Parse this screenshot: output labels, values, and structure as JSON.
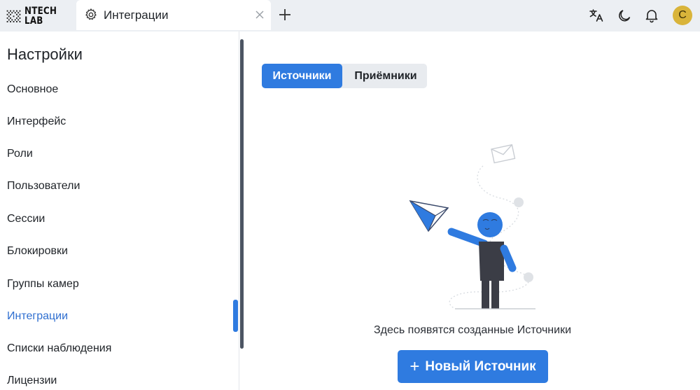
{
  "brand": {
    "line1": "NTECH",
    "line2": "LAB"
  },
  "tab": {
    "label": "Интеграции"
  },
  "user": {
    "initial": "C",
    "avatar_color": "#d9b43a"
  },
  "sidebar": {
    "title": "Настройки",
    "items": [
      {
        "label": "Основное",
        "active": false
      },
      {
        "label": "Интерфейс",
        "active": false
      },
      {
        "label": "Роли",
        "active": false
      },
      {
        "label": "Пользователи",
        "active": false
      },
      {
        "label": "Сессии",
        "active": false
      },
      {
        "label": "Блокировки",
        "active": false
      },
      {
        "label": "Группы камер",
        "active": false
      },
      {
        "label": "Интеграции",
        "active": true
      },
      {
        "label": "Списки наблюдения",
        "active": false
      },
      {
        "label": "Лицензии",
        "active": false
      }
    ]
  },
  "main": {
    "tabs": [
      {
        "label": "Источники",
        "selected": true
      },
      {
        "label": "Приёмники",
        "selected": false
      }
    ],
    "empty_message": "Здесь появятся созданные Источники",
    "primary_button": "Новый Источник"
  },
  "colors": {
    "accent": "#2f7be0",
    "active_text": "#2f6fd0",
    "topbar": "#eceff3"
  }
}
